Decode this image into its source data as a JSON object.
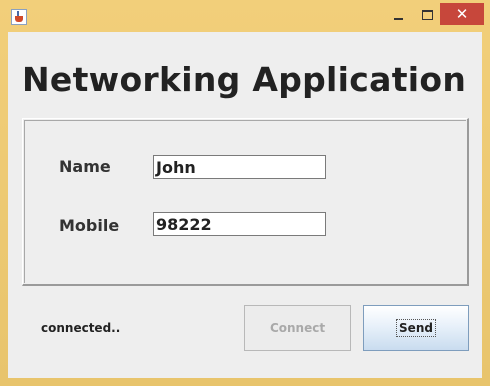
{
  "window": {
    "close_glyph": "✕",
    "icon": "java-app-icon"
  },
  "main": {
    "heading": "Networking Application",
    "name_label": "Name",
    "name_value": "John",
    "mobile_label": "Mobile",
    "mobile_value": "98222",
    "status": "connected..",
    "connect_label": "Connect",
    "send_label": "Send"
  },
  "colors": {
    "frame": "#e9c76f",
    "close_button": "#c7473b",
    "client_background": "#eeeeee"
  }
}
